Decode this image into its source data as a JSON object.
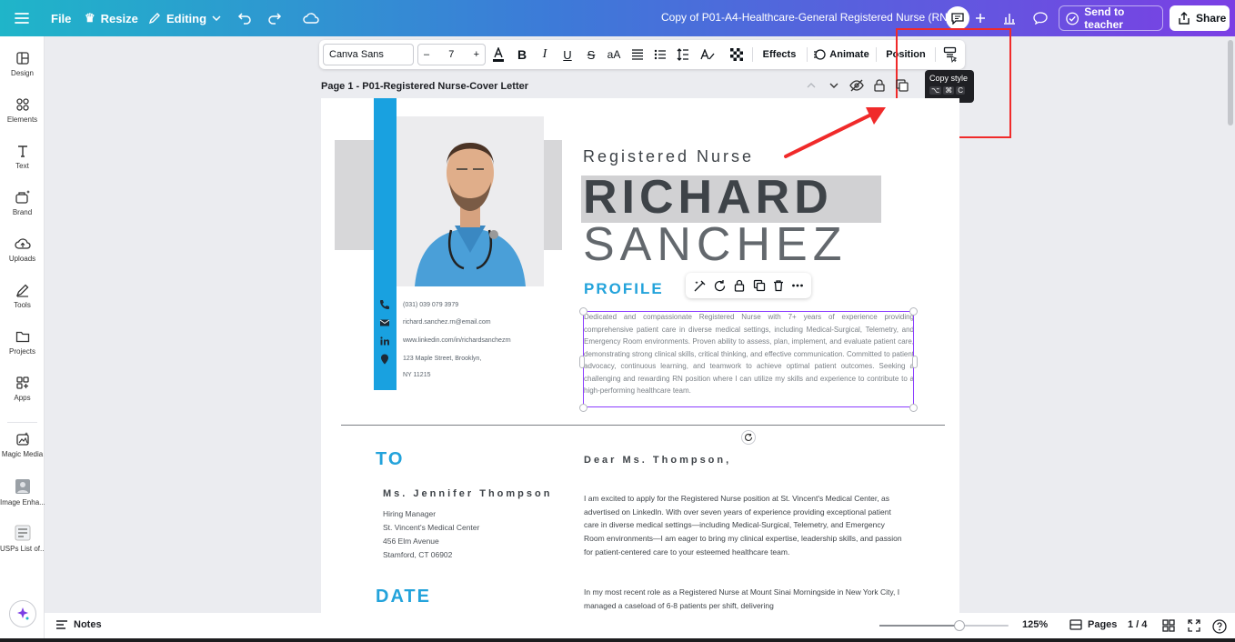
{
  "topbar": {
    "file_label": "File",
    "resize_label": "Resize",
    "editing_label": "Editing",
    "doc_title": "Copy of P01-A4-Healthcare-General Registered Nurse (RN) ...",
    "send_label": "Send to teacher",
    "share_label": "Share"
  },
  "sidebar": {
    "items": [
      {
        "label": "Design",
        "icon": "layout-icon"
      },
      {
        "label": "Elements",
        "icon": "shapes-icon"
      },
      {
        "label": "Text",
        "icon": "text-icon"
      },
      {
        "label": "Brand",
        "icon": "brand-icon"
      },
      {
        "label": "Uploads",
        "icon": "cloud-upload-icon"
      },
      {
        "label": "Tools",
        "icon": "pen-icon"
      },
      {
        "label": "Projects",
        "icon": "folder-icon"
      },
      {
        "label": "Apps",
        "icon": "apps-icon"
      },
      {
        "label": "Magic Media",
        "icon": "magic-media-icon"
      },
      {
        "label": "Image Enha...",
        "icon": "image-enhancer-icon"
      },
      {
        "label": "USPs List of...",
        "icon": "usps-app-icon"
      }
    ]
  },
  "toolbar": {
    "font": "Canva Sans",
    "size": "7",
    "minus": "–",
    "plus": "+",
    "effects_label": "Effects",
    "animate_label": "Animate",
    "position_label": "Position",
    "text_case": "aA"
  },
  "tooltip": {
    "title": "Copy style",
    "keys": [
      "⌥",
      "⌘",
      "C"
    ]
  },
  "page": {
    "label": "Page 1 - P01-Registered Nurse-Cover Letter"
  },
  "resume": {
    "role": "Registered Nurse",
    "first_name": "RICHARD",
    "last_name": "SANCHEZ",
    "profile_heading": "PROFILE",
    "profile_text": "Dedicated and compassionate Registered Nurse with 7+ years of experience providing comprehensive patient care in diverse medical settings, including Medical-Surgical, Telemetry, and Emergency Room environments. Proven ability to assess, plan, implement, and evaluate patient care, demonstrating strong clinical skills, critical thinking, and effective communication. Committed to patient advocacy, continuous learning, and teamwork to achieve optimal patient outcomes. Seeking a challenging and rewarding RN position where I can utilize my skills and experience to contribute to a high-performing healthcare team.",
    "contact": {
      "phone": "(031) 039 079 3979",
      "email": "richard.sanchez.rn@email.com",
      "linkedin": "www.linkedin.com/in/richardsanchezrn",
      "address_line1": "123 Maple Street, Brooklyn,",
      "address_line2": "NY 11215"
    },
    "to_heading": "TO",
    "recipient_name": "Ms. Jennifer Thompson",
    "recipient_lines": [
      "Hiring Manager",
      "St. Vincent's Medical Center",
      "456 Elm Avenue",
      "Stamford, CT 06902"
    ],
    "date_heading": "DATE",
    "salutation": "Dear Ms. Thompson,",
    "para1": "I am excited to apply for the Registered Nurse position at St. Vincent's Medical Center, as advertised on LinkedIn. With over seven years of experience providing exceptional patient care in diverse medical settings—including Medical-Surgical, Telemetry, and Emergency Room environments—I am eager to bring my clinical expertise, leadership skills, and passion for patient-centered care to your esteemed healthcare team.",
    "para2": "In my most recent role as a Registered Nurse at Mount Sinai Morningside in New York City, I managed a caseload of 6-8 patients per shift, delivering"
  },
  "bottombar": {
    "notes_label": "Notes",
    "zoom": "125%",
    "zoom_fraction": 0.62,
    "pages_label": "Pages",
    "page_count": "1 / 4"
  },
  "colors": {
    "accent_blue": "#23a3db",
    "annotation_red": "#f02a2a",
    "selection_purple": "#8b3dff"
  }
}
